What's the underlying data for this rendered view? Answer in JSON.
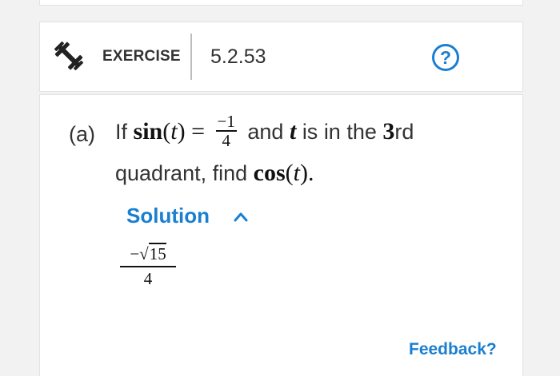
{
  "header": {
    "icon": "dumbbell-icon",
    "label": "EXERCISE",
    "number": "5.2.53",
    "help_icon": "question-circle-icon",
    "help_symbol": "?"
  },
  "question": {
    "part_label": "(a)",
    "if_text": "If",
    "sin_func": "sin",
    "var": "t",
    "open_paren": "(",
    "close_paren_eq": ") =",
    "frac_num": "−1",
    "frac_den": "4",
    "and_text": "and",
    "is_in_text": "is in the",
    "quadrant_num": "3",
    "quadrant_suffix": "rd",
    "line2_text": "quadrant, find",
    "cos_func": "cos",
    "end_punct": ")."
  },
  "solution": {
    "toggle_label": "Solution",
    "toggle_icon": "chevron-up-icon",
    "answer_sign": "−",
    "answer_radicand": "15",
    "answer_den": "4"
  },
  "footer": {
    "feedback_label": "Feedback?"
  },
  "colors": {
    "accent": "#1a7fd1",
    "background": "#f2f2f2",
    "card": "#ffffff"
  }
}
